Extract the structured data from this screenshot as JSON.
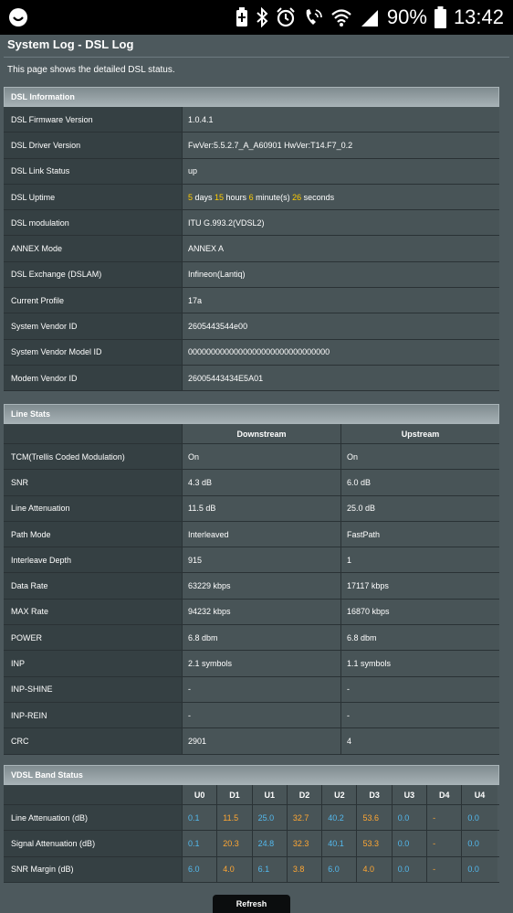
{
  "status_bar": {
    "battery_percent": "90%",
    "time": "13:42",
    "icons": [
      "app-icon",
      "battery-saver-icon",
      "bluetooth-icon",
      "alarm-icon",
      "wifi-calling-icon",
      "wifi-icon",
      "cellular-signal-icon",
      "battery-icon"
    ]
  },
  "page": {
    "title": "System Log - DSL Log",
    "description": "This page shows the detailed DSL status.",
    "refresh_label": "Refresh"
  },
  "dsl_info": {
    "header": "DSL Information",
    "rows": [
      {
        "label": "DSL Firmware Version",
        "value": "1.0.4.1"
      },
      {
        "label": "DSL Driver Version",
        "value": "FwVer:5.5.2.7_A_A60901 HwVer:T14.F7_0.2"
      },
      {
        "label": "DSL Link Status",
        "value": "up"
      },
      {
        "label": "DSL Uptime",
        "value": ""
      },
      {
        "label": "DSL modulation",
        "value": "ITU G.993.2(VDSL2)"
      },
      {
        "label": "ANNEX Mode",
        "value": "ANNEX A"
      },
      {
        "label": "DSL Exchange (DSLAM)",
        "value": "Infineon(Lantiq)"
      },
      {
        "label": "Current Profile",
        "value": "17a"
      },
      {
        "label": "System Vendor ID",
        "value": "2605443544e00"
      },
      {
        "label": "System Vendor Model ID",
        "value": "0000000000000000000000000000000"
      },
      {
        "label": "Modem Vendor ID",
        "value": "26005443434E5A01"
      }
    ],
    "uptime": {
      "days": "5",
      "days_label": " days ",
      "hours": "15",
      "hours_label": " hours ",
      "minutes": "6",
      "minutes_label": " minute(s) ",
      "seconds": "26",
      "seconds_label": " seconds"
    }
  },
  "line_stats": {
    "header": "Line Stats",
    "col_downstream": "Downstream",
    "col_upstream": "Upstream",
    "rows": [
      {
        "label": "TCM(Trellis Coded Modulation)",
        "down": "On",
        "up": "On"
      },
      {
        "label": "SNR",
        "down": "4.3 dB",
        "up": "6.0 dB"
      },
      {
        "label": "Line Attenuation",
        "down": "11.5 dB",
        "up": "25.0 dB"
      },
      {
        "label": "Path Mode",
        "down": "Interleaved",
        "up": "FastPath"
      },
      {
        "label": "Interleave Depth",
        "down": "915",
        "up": "1"
      },
      {
        "label": "Data Rate",
        "down": "63229 kbps",
        "up": "17117 kbps"
      },
      {
        "label": "MAX Rate",
        "down": "94232 kbps",
        "up": "16870 kbps"
      },
      {
        "label": "POWER",
        "down": "6.8 dbm",
        "up": "6.8 dbm"
      },
      {
        "label": "INP",
        "down": "2.1 symbols",
        "up": "1.1 symbols"
      },
      {
        "label": "INP-SHINE",
        "down": "-",
        "up": "-"
      },
      {
        "label": "INP-REIN",
        "down": "-",
        "up": "-"
      },
      {
        "label": "CRC",
        "down": "2901",
        "up": "4"
      }
    ]
  },
  "vdsl_band": {
    "header": "VDSL Band Status",
    "columns": [
      "U0",
      "D1",
      "U1",
      "D2",
      "U2",
      "D3",
      "U3",
      "D4",
      "U4"
    ],
    "rows": [
      {
        "label": "Line Attenuation (dB)",
        "values": [
          "0.1",
          "11.5",
          "25.0",
          "32.7",
          "40.2",
          "53.6",
          "0.0",
          "-",
          "0.0"
        ]
      },
      {
        "label": "Signal Attenuation (dB)",
        "values": [
          "0.1",
          "20.3",
          "24.8",
          "32.3",
          "40.1",
          "53.3",
          "0.0",
          "-",
          "0.0"
        ]
      },
      {
        "label": "SNR Margin (dB)",
        "values": [
          "6.0",
          "4.0",
          "6.1",
          "3.8",
          "6.0",
          "4.0",
          "0.0",
          "-",
          "0.0"
        ]
      }
    ]
  },
  "colors": {
    "upstream_value": "#53b9ee",
    "downstream_value": "#ffa733",
    "highlight_number": "#ffcc00"
  }
}
